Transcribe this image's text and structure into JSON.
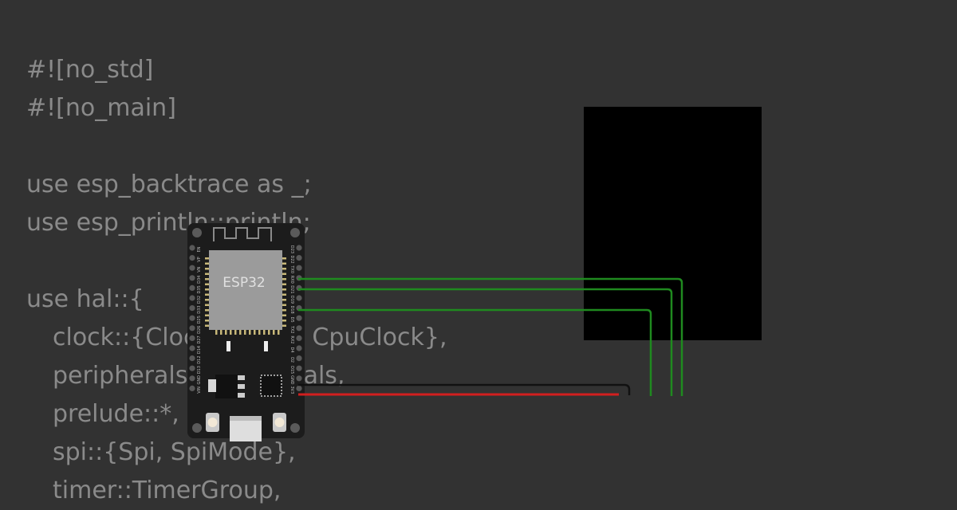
{
  "editor": {
    "lines": [
      "#![no_std]",
      "#![no_main]",
      "",
      "use esp_backtrace as _;",
      "use esp_println::println;",
      "",
      "use hal::{",
      "clock::{ClockControl, CpuClock},",
      "peripherals::Peripherals,",
      "prelude::*,",
      "spi::{Spi, SpiMode},",
      "timer::TimerGroup,"
    ]
  },
  "board": {
    "chip_label": "ESP32",
    "left_pins": [
      "EN",
      "VP",
      "VN",
      "D34",
      "D35",
      "D32",
      "D33",
      "D25",
      "D26",
      "D27",
      "D14",
      "D12",
      "D13",
      "GND",
      "VIN"
    ],
    "right_pins": [
      "D23",
      "D22",
      "TX0",
      "RX0",
      "D21",
      "D19",
      "D18",
      "D5",
      "TX2",
      "RX2",
      "D4",
      "D2",
      "D15",
      "GND",
      "3V3"
    ]
  },
  "display": {
    "label": ""
  },
  "colors": {
    "background": "#323232",
    "code_text": "#8a8a8a",
    "board": "#1c1c1c",
    "module_shield": "#9b9b9b",
    "wire_signal": "#1f8a1f",
    "wire_power": "#d21f1f",
    "wire_ground": "#111111",
    "display": "#000000"
  }
}
